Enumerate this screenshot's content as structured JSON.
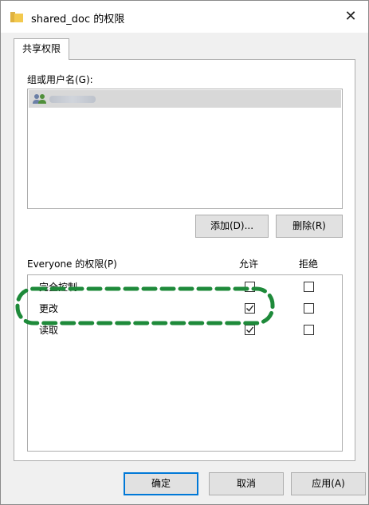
{
  "window": {
    "title": "shared_doc 的权限",
    "close_glyph": "✕",
    "folder_icon": "folder-icon"
  },
  "tab": {
    "label": "共享权限"
  },
  "groups": {
    "label": "组或用户名(G):",
    "items": [
      {
        "icon": "users-icon",
        "name_redacted": true,
        "selected": true
      }
    ]
  },
  "group_buttons": {
    "add": "添加(D)...",
    "remove": "删除(R)"
  },
  "permissions": {
    "label": "Everyone 的权限(P)",
    "allow_header": "允许",
    "deny_header": "拒绝",
    "rows": [
      {
        "name": "完全控制",
        "allow": false,
        "deny": false
      },
      {
        "name": "更改",
        "allow": true,
        "deny": false
      },
      {
        "name": "读取",
        "allow": true,
        "deny": false
      }
    ]
  },
  "footer": {
    "ok": "确定",
    "cancel": "取消",
    "apply": "应用(A)"
  },
  "annotation": {
    "color": "#1e8a3a"
  }
}
